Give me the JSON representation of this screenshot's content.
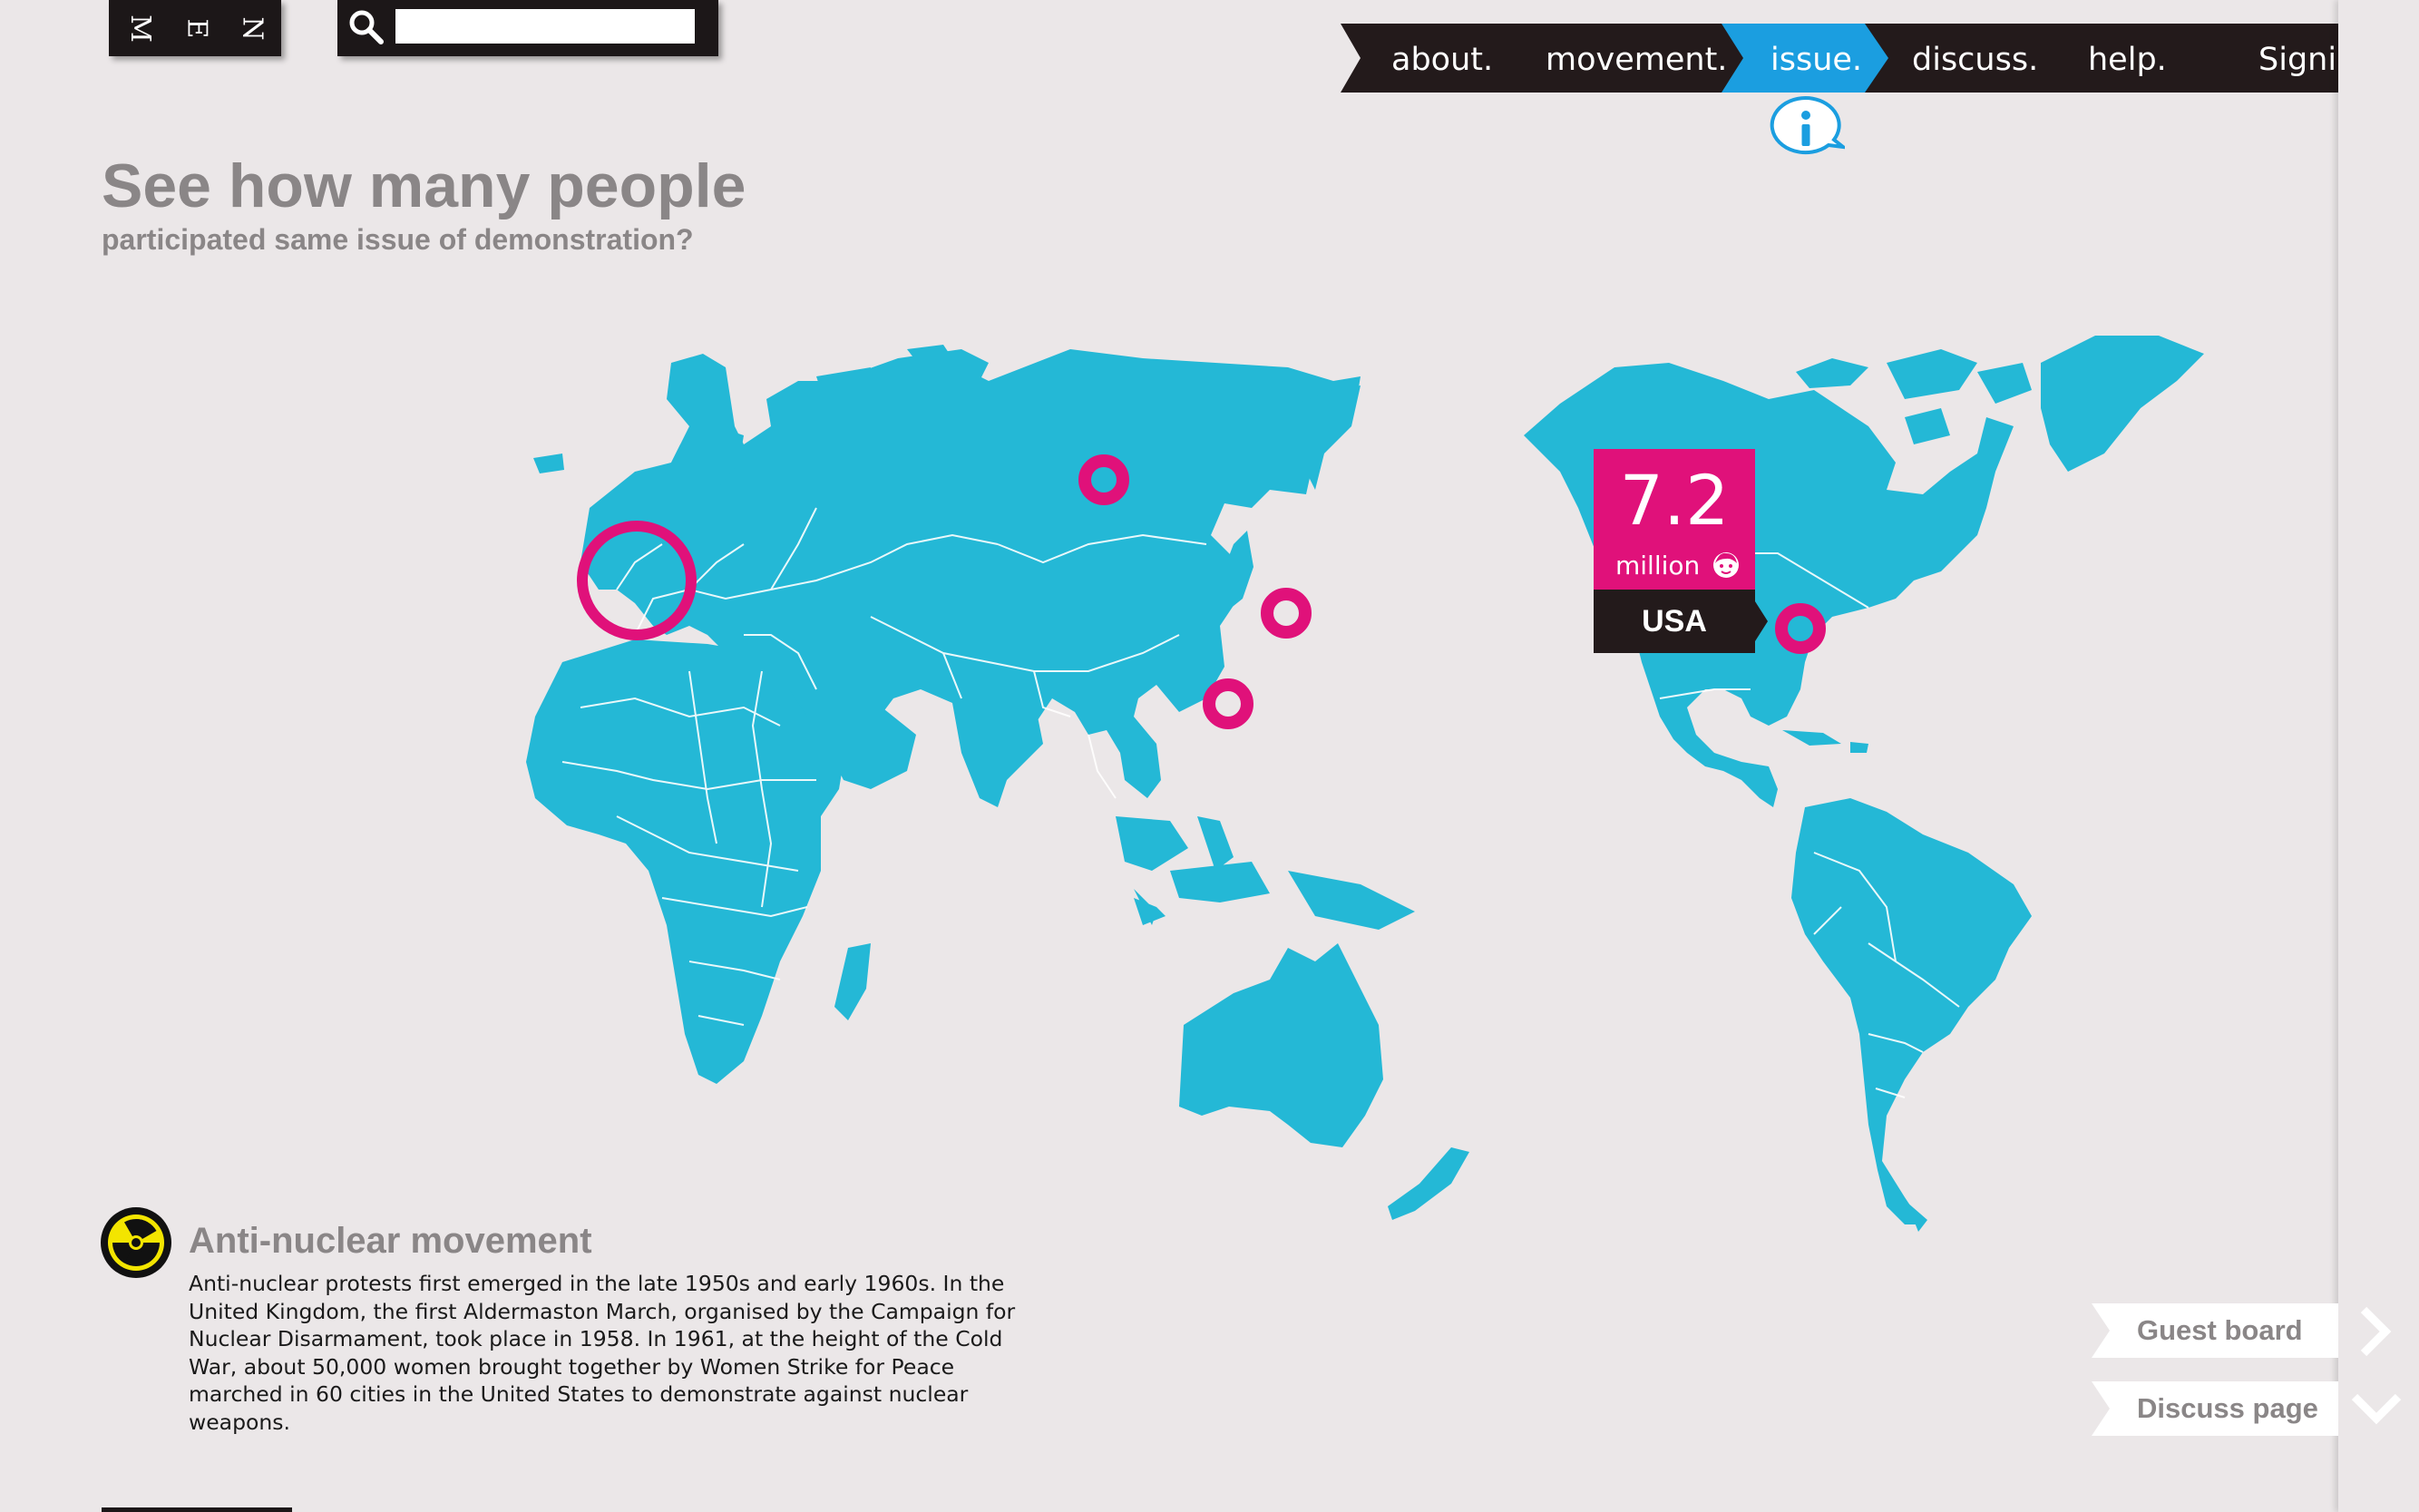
{
  "menu": {
    "letters": [
      "M",
      "E",
      "N"
    ]
  },
  "search": {
    "value": "",
    "placeholder": ""
  },
  "nav": {
    "items": [
      "about.",
      "movement.",
      "issue.",
      "discuss.",
      "help.",
      "Signin."
    ],
    "active": "issue."
  },
  "heading": {
    "title": "See how many people",
    "subtitle": "participated same issue of demonstration?"
  },
  "stat": {
    "value": "7.2",
    "unit": "million",
    "country": "USA"
  },
  "movement": {
    "title": "Anti-nuclear movement",
    "description": "Anti-nuclear protests first emerged in the late 1950s and early 1960s. In the United Kingdom, the first Aldermaston March, organised by the Campaign for Nuclear Disarmament, took place in 1958. In 1961, at the height of the Cold War, about 50,000 women brought together by Women Strike for Peace marched in 60 cities in the United States to demonstrate against nuclear weapons."
  },
  "side_buttons": {
    "guest_board": "Guest board",
    "discuss_page": "Discuss page"
  },
  "colors": {
    "background": "#ebe7e8",
    "map": "#24b8d6",
    "marker": "#e0117a",
    "nav_bar": "#231a1b",
    "nav_active": "#1b9ee0",
    "heading": "#8a8687"
  },
  "icons": [
    "search-icon",
    "info-icon",
    "radiation-icon",
    "child-face-icon",
    "chevron-right-icon",
    "chevron-down-icon"
  ]
}
